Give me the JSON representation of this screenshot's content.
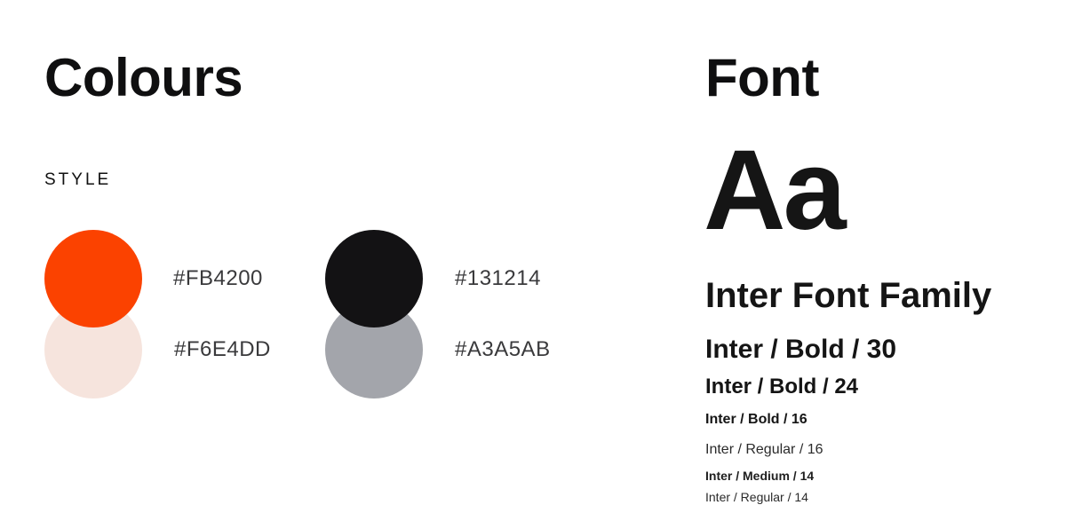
{
  "colours_section": {
    "title": "Colours",
    "style_label": "STYLE",
    "swatches": [
      {
        "hex": "#FB4200",
        "color": "#FB4200"
      },
      {
        "hex": "#F6E4DD",
        "color": "#F6E4DD"
      },
      {
        "hex": "#131214",
        "color": "#131214"
      },
      {
        "hex": "#A3A5AB",
        "color": "#A3A5AB"
      }
    ]
  },
  "font_section": {
    "title": "Font",
    "specimen": "Aa",
    "family_name": "Inter Font Family",
    "samples": [
      "Inter / Bold / 30",
      "Inter / Bold / 24",
      "Inter / Bold / 16",
      "Inter / Regular / 16",
      "Inter / Medium / 14",
      "Inter / Regular / 14"
    ]
  }
}
